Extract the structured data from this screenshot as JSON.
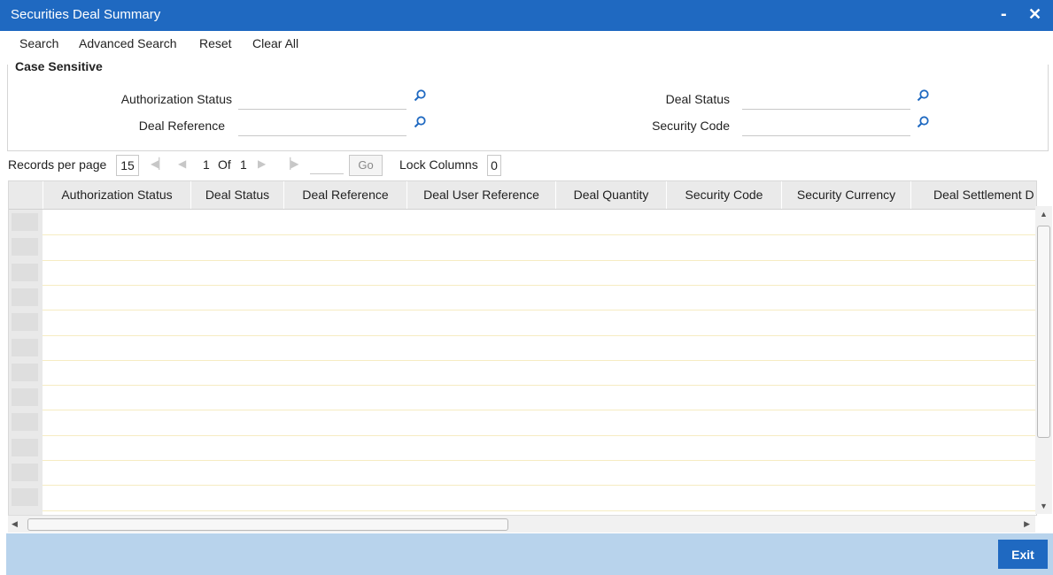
{
  "window": {
    "title": "Securities Deal Summary",
    "minimize_label": "-",
    "close_label": "✕"
  },
  "toolbar": {
    "search": "Search",
    "advanced_search": "Advanced Search",
    "reset": "Reset",
    "clear_all": "Clear All"
  },
  "criteria": {
    "legend": "Case Sensitive",
    "authorization_status": {
      "label": "Authorization Status",
      "value": ""
    },
    "deal_status": {
      "label": "Deal Status",
      "value": ""
    },
    "deal_reference": {
      "label": "Deal Reference",
      "value": ""
    },
    "security_code": {
      "label": "Security Code",
      "value": ""
    }
  },
  "pager": {
    "records_per_page_label": "Records per page",
    "records_per_page": "15",
    "current_page": "1",
    "of_label": "Of",
    "total_pages": "1",
    "go_label": "Go",
    "lock_columns_label": "Lock Columns",
    "lock_columns": "0"
  },
  "grid": {
    "columns": [
      "Authorization Status",
      "Deal Status",
      "Deal Reference",
      "Deal User Reference",
      "Deal Quantity",
      "Security Code",
      "Security Currency",
      "Deal Settlement D"
    ],
    "rows": []
  },
  "footer": {
    "exit_label": "Exit"
  },
  "colors": {
    "titlebar": "#1f69c1",
    "footer": "#b8d3ec",
    "row_line": "#f6ecc2"
  }
}
